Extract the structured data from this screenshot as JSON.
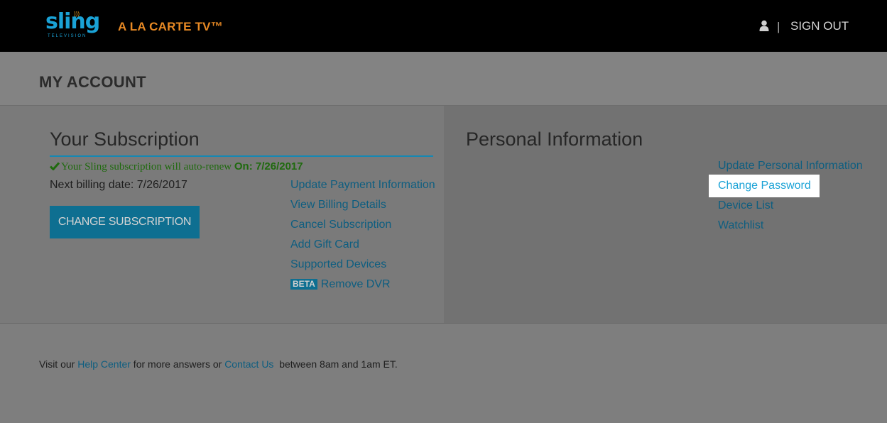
{
  "header": {
    "logo_text": "sling",
    "logo_sub": "TELEVISION",
    "tagline": "A LA CARTE TV™",
    "divider": "|",
    "signout_label": "SIGN OUT"
  },
  "page": {
    "title": "MY ACCOUNT"
  },
  "subscription": {
    "heading": "Your Subscription",
    "renew_message": "Your Sling subscription will auto-renew ",
    "renew_date": "On: 7/26/2017",
    "billing_date": "Next billing date: 7/26/2017",
    "change_button": "CHANGE SUBSCRIPTION",
    "links": [
      "Update Payment Information",
      "View Billing Details",
      "Cancel Subscription",
      "Add Gift Card",
      "Supported Devices"
    ],
    "beta_badge": "BETA",
    "remove_dvr": "Remove DVR"
  },
  "personal": {
    "heading": "Personal Information",
    "links": [
      "Update Personal Information",
      "Change Password",
      "Device List",
      "Watchlist"
    ]
  },
  "footer": {
    "text_1": "Visit our ",
    "help_center": "Help Center",
    "text_2": " for more answers or ",
    "contact_us": "Contact Us",
    "text_3": "  between 8am and 1am ET."
  },
  "colors": {
    "brand_blue": "#1aa2d6",
    "tagline_orange": "#e98a24",
    "renew_green": "#1f6a0e",
    "button_blue": "#0e6f91"
  },
  "icons": {
    "logo": "sling-logo",
    "user": "user-icon",
    "check": "check-icon"
  }
}
